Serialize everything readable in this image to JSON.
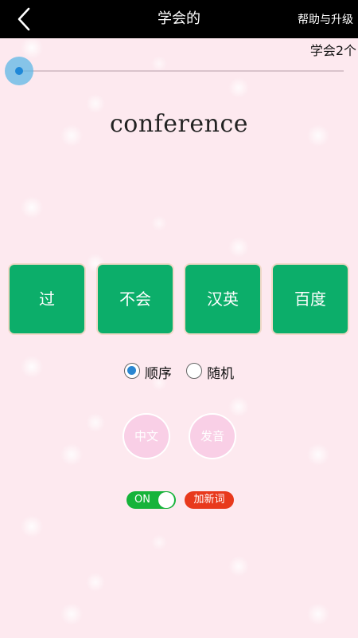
{
  "header": {
    "title": "学会的",
    "help_label": "帮助与升级",
    "back_icon": "chevron-left-icon"
  },
  "learned_count_text": "学会2个",
  "progress": {
    "value": 0,
    "accent_color": "#5db7e6"
  },
  "word": "conference",
  "actions": [
    {
      "name": "pass-button",
      "label": "过"
    },
    {
      "name": "dont-know-button",
      "label": "不会"
    },
    {
      "name": "chinese-english-button",
      "label": "汉英"
    },
    {
      "name": "baidu-button",
      "label": "百度"
    }
  ],
  "order": {
    "options": [
      {
        "name": "sequential",
        "label": "顺序",
        "checked": true
      },
      {
        "name": "random",
        "label": "随机",
        "checked": false
      }
    ]
  },
  "circle_buttons": [
    {
      "name": "chinese-button",
      "label": "中文"
    },
    {
      "name": "pronunciation-button",
      "label": "发音"
    }
  ],
  "toggle": {
    "label": "ON",
    "on": true,
    "color": "#16b33a"
  },
  "add_word_label": "加新词",
  "colors": {
    "action_green": "#0cae6a",
    "add_red": "#e8391c",
    "background_pink": "#fde9ef"
  }
}
